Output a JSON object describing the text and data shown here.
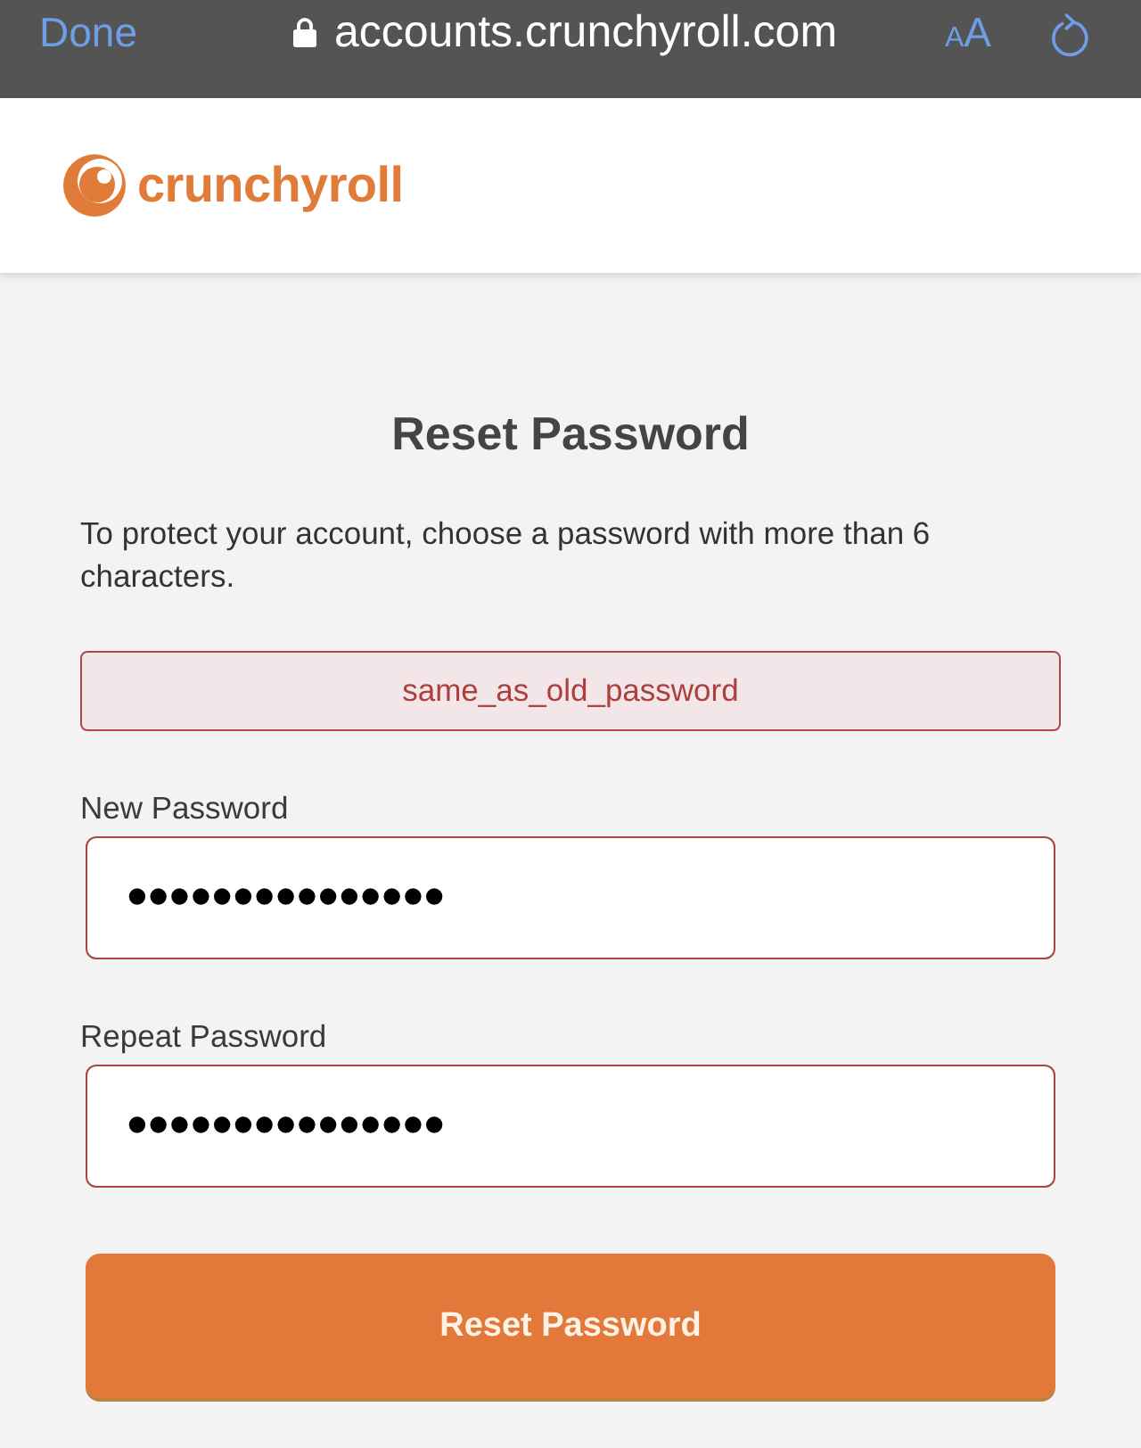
{
  "browser_bar": {
    "done": "Done",
    "url": "accounts.crunchyroll.com",
    "text_size": "AA"
  },
  "header": {
    "logo_text": "crunchyroll"
  },
  "form": {
    "title": "Reset Password",
    "intro": "To protect your account, choose a password with more than 6 characters.",
    "error": "same_as_old_password",
    "fields": [
      {
        "label": "New Password",
        "value": "•••••••••••••••",
        "invalid": true
      },
      {
        "label": "Repeat Password",
        "value": "•••••••••••••••",
        "invalid": true
      }
    ],
    "submit": "Reset Password"
  }
}
